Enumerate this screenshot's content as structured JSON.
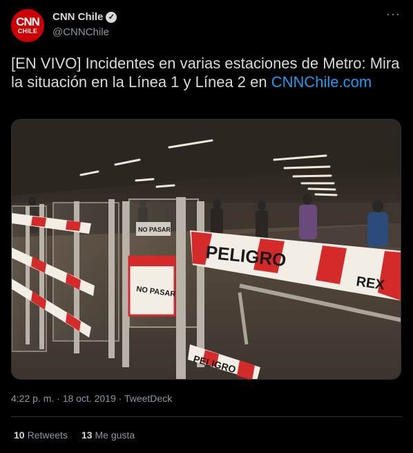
{
  "author": {
    "logo_top": "CNN",
    "logo_bottom": "CHILE",
    "name": "CNN Chile",
    "handle": "@CNNChile",
    "verified_icon": "verified-badge-icon"
  },
  "more_icon": "···",
  "tweet": {
    "text": "[EN VIVO] Incidentes en varias estaciones de Metro: Mira la situación en la Línea 1 y Línea 2 en ",
    "link": "CNNChile.com",
    "timestamp": "4:22 p. m. · 18 oct. 2019 · TweetDeck"
  },
  "media": {
    "tape_text_1": "PELIGRO",
    "tape_text_2": "REX",
    "tape_text_3": "PELIGRO",
    "sign_text": "NO PASAR",
    "sign_text_2": "NO PASAR"
  },
  "stats": {
    "retweets_count": "10",
    "retweets_label": "Retweets",
    "likes_count": "13",
    "likes_label": "Me gusta"
  },
  "colors": {
    "link": "#1d9bf0",
    "brand": "#cc0000",
    "secondary_text": "#8899a6"
  }
}
